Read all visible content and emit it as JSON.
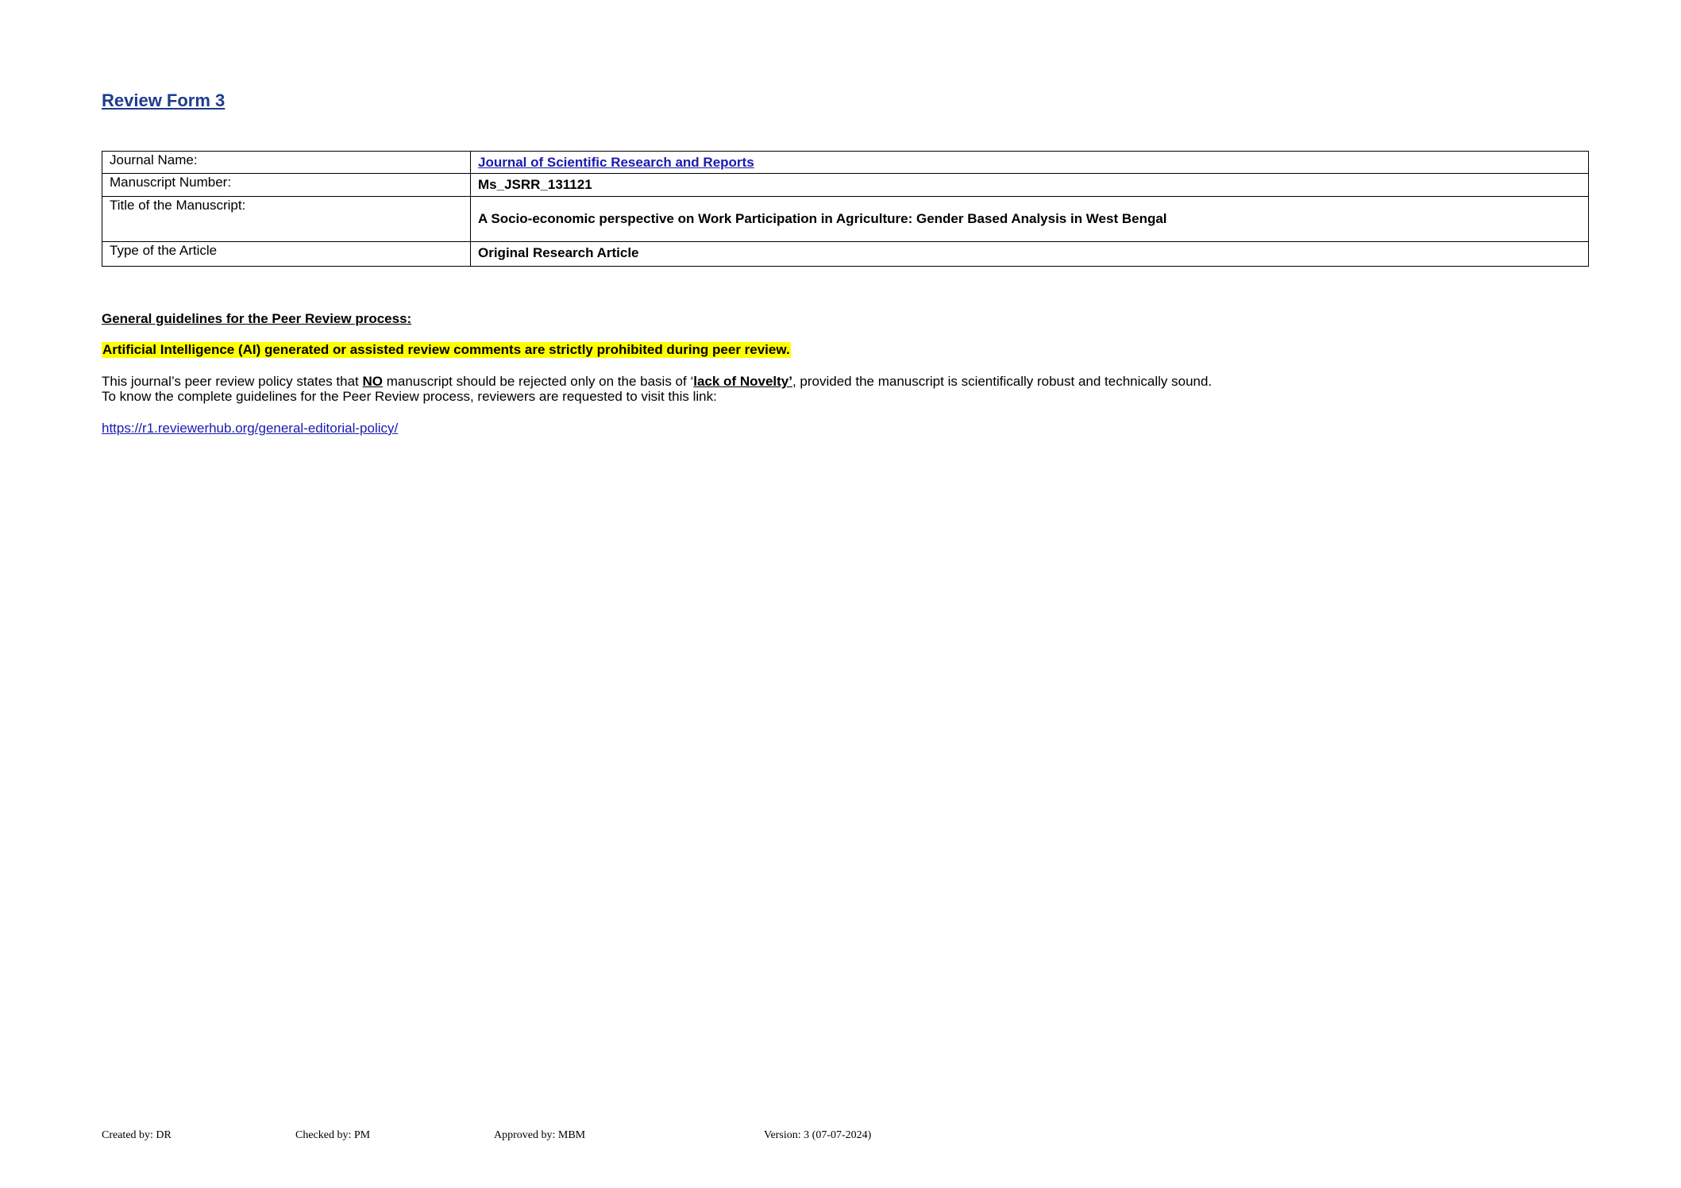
{
  "header": {
    "title": "Review Form 3"
  },
  "info_table": {
    "rows": [
      {
        "label": "Journal Name:",
        "value": "Journal of Scientific Research and Reports"
      },
      {
        "label": "Manuscript Number:",
        "value": "Ms_JSRR_131121"
      },
      {
        "label": "Title of the Manuscript:",
        "value": "A Socio-economic perspective on Work Participation in Agriculture: Gender Based Analysis in West Bengal"
      },
      {
        "label": "Type of the Article",
        "value": "Original Research Article"
      }
    ]
  },
  "guidelines": {
    "heading": "General guidelines for the Peer Review process:",
    "ai_warning": "Artificial Intelligence (AI) generated or assisted review comments are strictly prohibited during peer review.",
    "policy_part1": "This journal’s peer review policy states that ",
    "policy_no": "NO",
    "policy_part2": " manuscript should be rejected only on the basis of ‘",
    "policy_novelty": "lack of Novelty’",
    "policy_part3": ", provided the manuscript is scientifically robust and technically sound.",
    "policy_line2": "To know the complete guidelines for the Peer Review process, reviewers are requested to visit this link:",
    "link": "https://r1.reviewerhub.org/general-editorial-policy/"
  },
  "footer": {
    "created": "Created by: DR",
    "checked": "Checked by: PM",
    "approved": "Approved by: MBM",
    "version": "Version: 3 (07-07-2024)"
  },
  "colors": {
    "title": "#1f3b8f",
    "link": "#1a1ab0",
    "highlight": "#ffff00"
  }
}
